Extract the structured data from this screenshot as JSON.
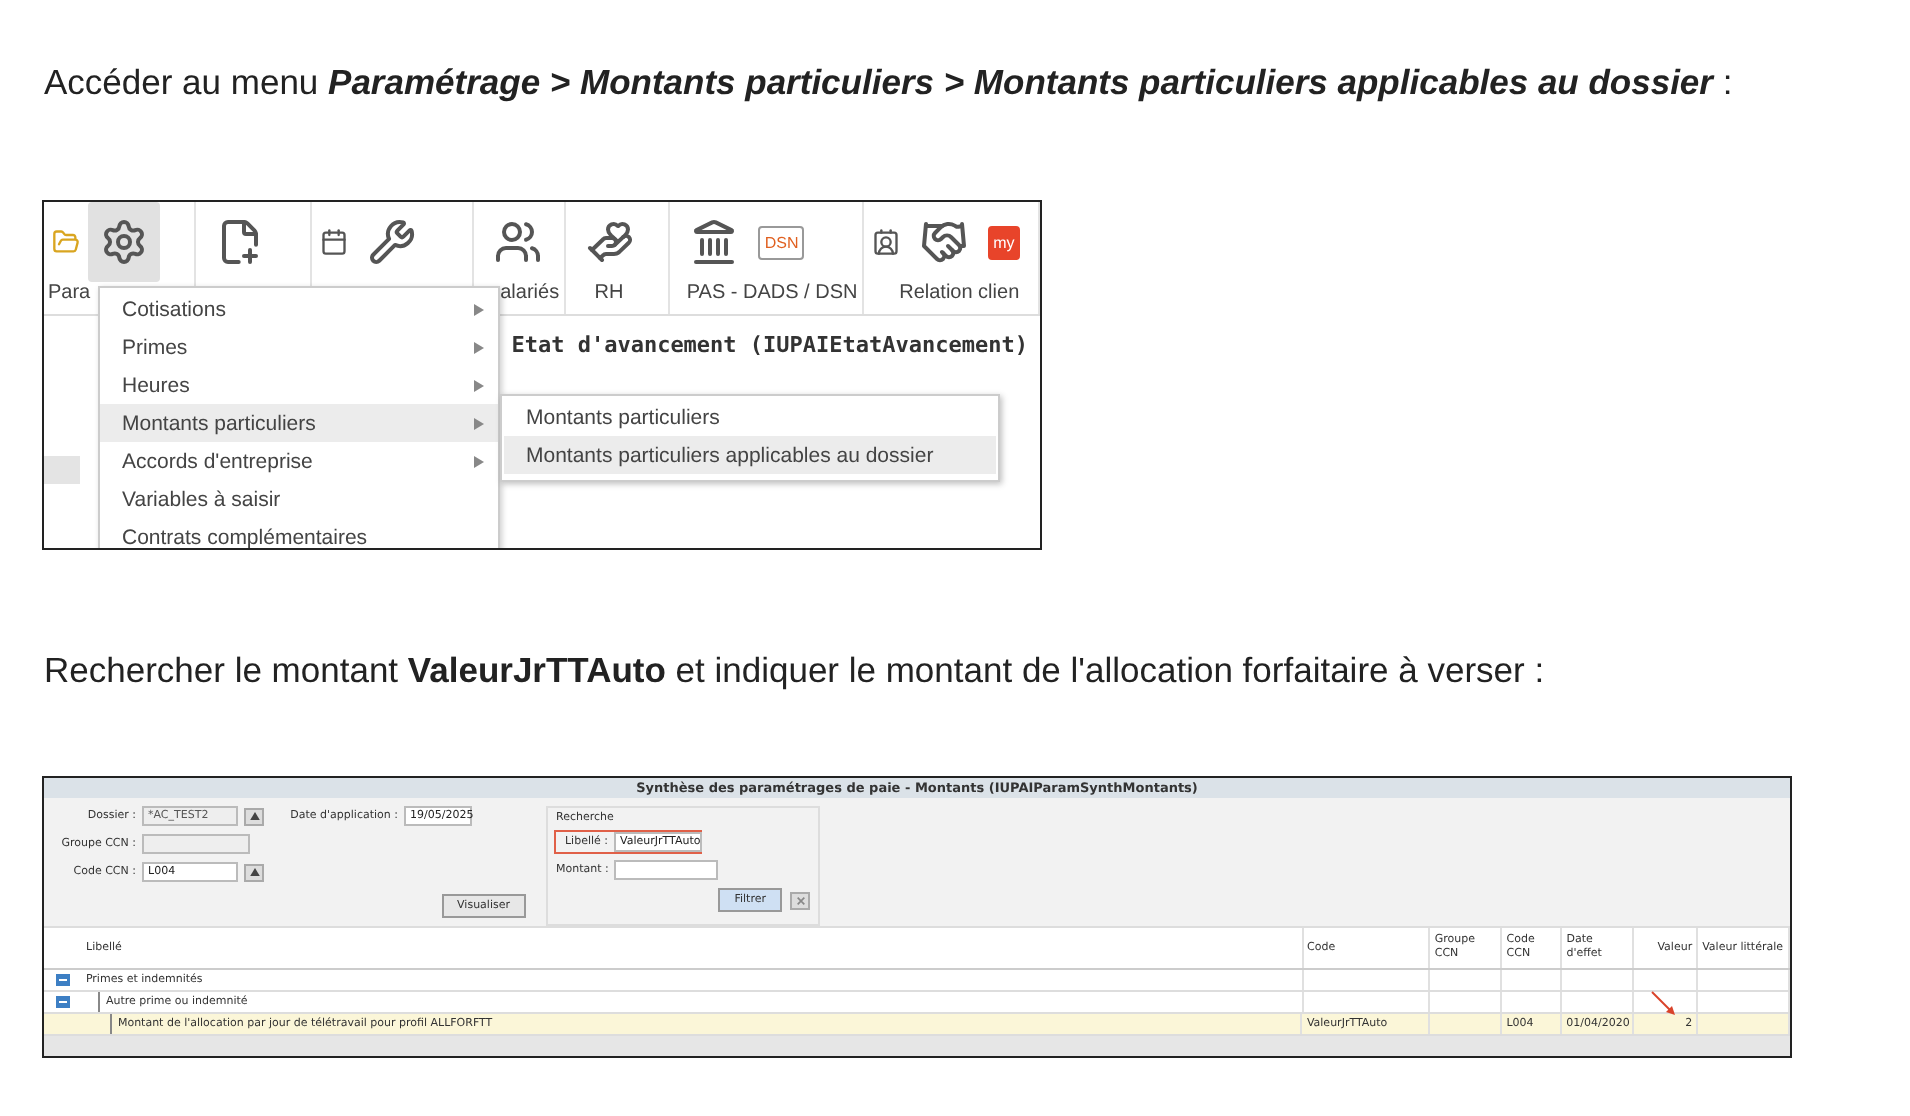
{
  "step_1": {
    "text": "Accéder au menu **Paramétrage > Montants particuliers > Montants particuliers applicables au dossier** :",
    "screenshot": {
      "toolbar": [
        {
          "label": "Para",
          "pressed": true
        },
        {
          "pressed": false
        },
        {
          "pressed": false
        },
        {
          "label": "alariés",
          "pressed": false
        },
        {
          "label": "RH",
          "pressed": false
        },
        {
          "label": "PAS - DADS / DSN",
          "pressed": false,
          "badge": "DSN"
        },
        {
          "label": "Relation clien",
          "pressed": false,
          "badge": "my"
        }
      ],
      "window_title": "Etat d'avancement (IUPAIEtatAvancement)",
      "menu": [
        {
          "label": "Cotisations",
          "submenu": true,
          "selected": false
        },
        {
          "label": "Primes",
          "submenu": true,
          "selected": false
        },
        {
          "label": "Heures",
          "submenu": true,
          "selected": false
        },
        {
          "label": "Montants particuliers",
          "submenu": true,
          "selected": true
        },
        {
          "label": "Accords d'entreprise",
          "submenu": true,
          "selected": false
        },
        {
          "label": "Variables à saisir",
          "submenu": false,
          "selected": false
        },
        {
          "label": "Contrats complémentaires",
          "submenu": false,
          "selected": false
        }
      ],
      "submenu": [
        {
          "label": "Montants particuliers",
          "selected": false
        },
        {
          "label": "Montants particuliers applicables au dossier",
          "selected": true
        }
      ]
    }
  },
  "step_2": {
    "text": "Rechercher le montant **ValeurJrTTAuto** et indiquer le montant de l'allocation forfaitaire à verser :",
    "screenshot": {
      "title": "Synthèse des paramétrages de paie - Montants (IUPAIParamSynthMontants)",
      "fields": [
        {
          "label": "Dossier :",
          "value": "*AC_TEST2",
          "button": true,
          "disabled": true
        },
        {
          "label": "Groupe CCN :",
          "button": false,
          "disabled": true
        },
        {
          "label": "Code CCN :",
          "value": "L004",
          "button": true,
          "disabled": false
        }
      ],
      "date": {
        "label": "Date d'application :",
        "value": "19/05/2025"
      },
      "visualize_button": "Visualiser",
      "search": {
        "title": "Recherche",
        "fields": [
          {
            "label": "Libellé :",
            "value": "ValeurJrTTAuto",
            "highlighted": true
          },
          {
            "label": "Montant :",
            "highlighted": false
          }
        ],
        "filter_button": "Filtrer"
      },
      "columns": [
        "Libellé",
        "Code",
        "Groupe CCN",
        "Code CCN",
        "Date d'effet",
        "Valeur",
        "Valeur littérale"
      ],
      "rows": [
        {
          "label": "Primes et indemnités",
          "expanded": true,
          "selected": false,
          "arrow": false,
          "children": [
            {
              "label": "Autre prime ou indemnité",
              "expanded": true,
              "selected": false,
              "arrow": false,
              "children": [
                {
                  "label": "Montant de l'allocation par jour de télétravail pour profil ALLFORFTT",
                  "code": "ValeurJrTTAuto",
                  "code_ccn": "L004",
                  "date": "01/04/2020",
                  "value": "2",
                  "selected": true,
                  "arrow": true
                }
              ]
            }
          ]
        }
      ]
    }
  }
}
